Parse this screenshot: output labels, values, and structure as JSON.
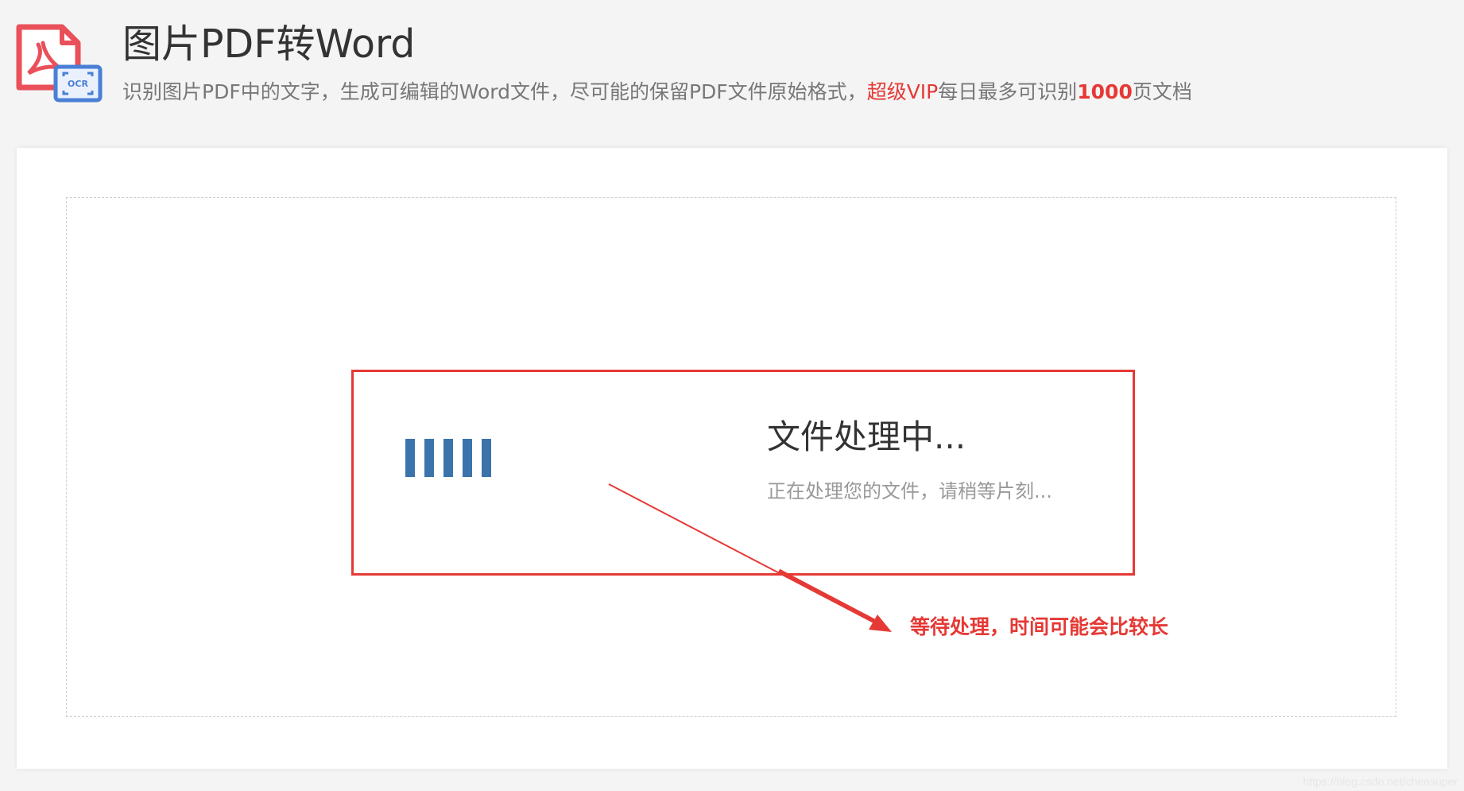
{
  "header": {
    "title": "图片PDF转Word",
    "subtitle_prefix": "识别图片PDF中的文字，生成可编辑的Word文件，尽可能的保留PDF文件原始格式，",
    "subtitle_vip": "超级VIP",
    "subtitle_mid": "每日最多可识别",
    "subtitle_limit": "1000",
    "subtitle_suffix": "页文档",
    "icon_label": "OCR"
  },
  "processing": {
    "title": "文件处理中...",
    "description": "正在处理您的文件，请稍等片刻..."
  },
  "annotation": {
    "text": "等待处理，时间可能会比较长"
  },
  "watermark": "https://blog.csdn.net/chensuper",
  "colors": {
    "accent_red": "#e53935",
    "loader_blue": "#3b73ab",
    "pdf_red": "#e9505a",
    "ocr_blue": "#4a7fd6"
  },
  "icons": {
    "app_icon": "pdf-ocr-icon",
    "loader": "loading-bars-icon"
  }
}
